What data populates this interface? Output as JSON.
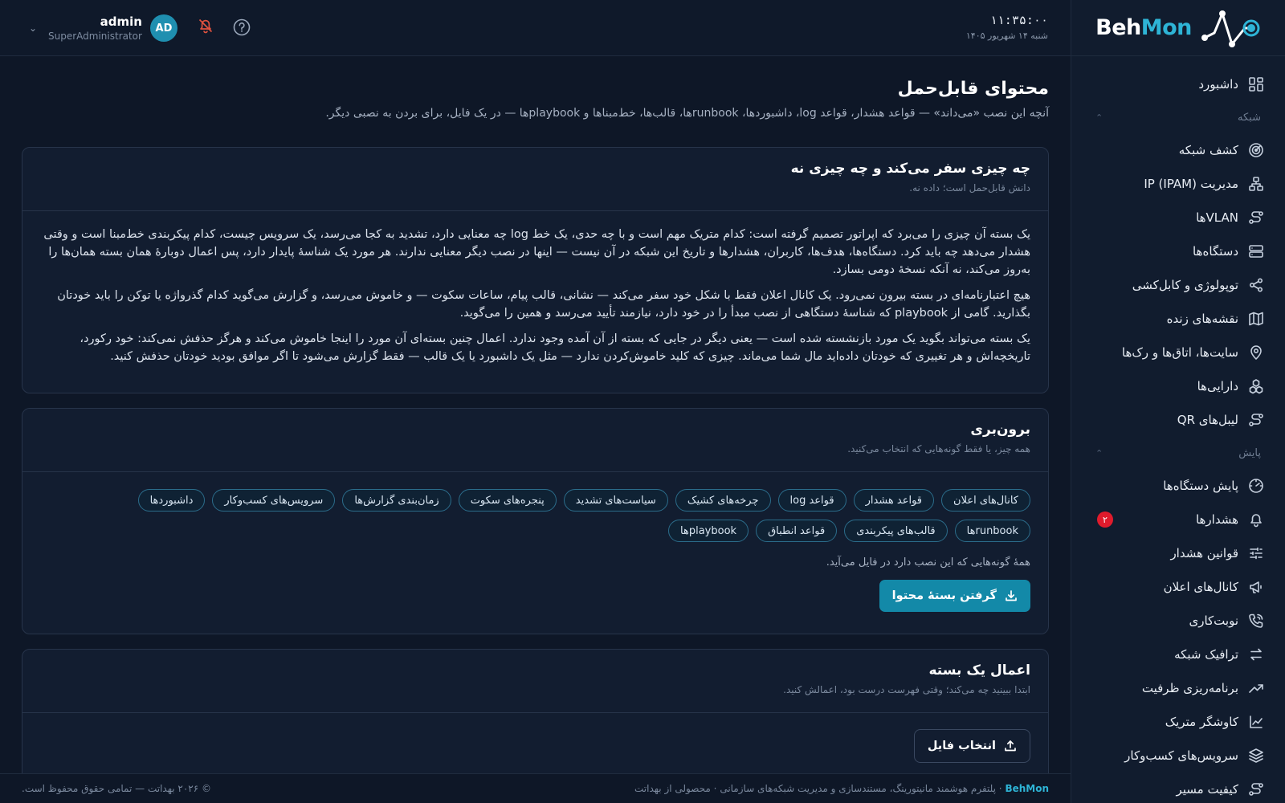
{
  "brand": {
    "part1": "Beh",
    "part2": "Mon"
  },
  "header": {
    "time": "۱۱:۳۵:۰۰",
    "date": "شنبه ۱۴ شهریور ۱۴۰۵",
    "user_name": "admin",
    "user_role": "SuperAdministrator",
    "avatar_initials": "AD"
  },
  "sidebar": {
    "dashboard": "داشبورد",
    "section_network": "شبکه",
    "network_items": [
      {
        "label": "کشف شبکه",
        "icon": "radar-icon"
      },
      {
        "label": "مدیریت IP (IPAM)",
        "icon": "network-tree-icon"
      },
      {
        "label": "VLANها",
        "icon": "route-icon"
      },
      {
        "label": "دستگاه‌ها",
        "icon": "server-icon"
      },
      {
        "label": "توپولوژی و کابل‌کشی",
        "icon": "share-icon"
      },
      {
        "label": "نقشه‌های زنده",
        "icon": "map-icon"
      },
      {
        "label": "سایت‌ها، اتاق‌ها و رک‌ها",
        "icon": "pin-icon"
      },
      {
        "label": "دارایی‌ها",
        "icon": "boxes-icon"
      },
      {
        "label": "لیبل‌های QR",
        "icon": "route-icon"
      }
    ],
    "section_monitor": "پایش",
    "monitor_items": [
      {
        "label": "پایش دستگاه‌ها",
        "icon": "gauge-icon",
        "badge": ""
      },
      {
        "label": "هشدارها",
        "icon": "bell-icon",
        "badge": "۲"
      },
      {
        "label": "قوانین هشدار",
        "icon": "sliders-icon",
        "badge": ""
      },
      {
        "label": "کانال‌های اعلان",
        "icon": "megaphone-icon",
        "badge": ""
      },
      {
        "label": "نوبت‌کاری",
        "icon": "phone-icon",
        "badge": ""
      },
      {
        "label": "ترافیک شبکه",
        "icon": "arrows-icon",
        "badge": ""
      },
      {
        "label": "برنامه‌ریزی ظرفیت",
        "icon": "trend-icon",
        "badge": ""
      },
      {
        "label": "کاوشگر متریک",
        "icon": "line-chart-icon",
        "badge": ""
      },
      {
        "label": "سرویس‌های کسب‌وکار",
        "icon": "layers-icon",
        "badge": ""
      },
      {
        "label": "کیفیت مسیر",
        "icon": "route-icon",
        "badge": ""
      }
    ]
  },
  "page": {
    "title": "محتوای قابل‌حمل",
    "subtitle": "آنچه این نصب «می‌داند» — قواعد هشدار، قواعد log، داشبوردها، runbookها، قالب‌ها، خط‌مبناها و playbookها — در یک فایل، برای بردن به نصبی دیگر."
  },
  "card1": {
    "title": "چه چیزی سفر می‌کند و چه چیزی نه",
    "subtitle": "دانش قابل‌حمل است؛ داده نه.",
    "paragraphs": [
      "یک بسته آن چیزی را می‌برد که اپراتور تصمیم گرفته است: کدام متریک مهم است و با چه حدی، یک خط log چه معنایی دارد، تشدید به کجا می‌رسد، یک سرویس چیست، کدام پیکربندی خط‌مبنا است و وقتی هشدار می‌دهد چه باید کرد. دستگاه‌ها، هدف‌ها، کاربران، هشدارها و تاریخ این شبکه در آن نیست — اینها در نصب دیگر معنایی ندارند. هر مورد یک شناسهٔ پایدار دارد، پس اعمال دوبارهٔ همان بسته همان‌ها را به‌روز می‌کند، نه آنکه نسخهٔ دومی بسازد.",
      "هیچ اعتبارنامه‌ای در بسته بیرون نمی‌رود. یک کانال اعلان فقط با شکل خود سفر می‌کند — نشانی، قالب پیام، ساعات سکوت — و خاموش می‌رسد، و گزارش می‌گوید کدام گذرواژه یا توکن را باید خودتان بگذارید. گامی از playbook که شناسهٔ دستگاهی از نصب مبدأ را در خود دارد، نیازمند تأیید می‌رسد و همین را می‌گوید.",
      "یک بسته می‌تواند بگوید یک مورد بازنشسته شده است — یعنی دیگر در جایی که بسته از آن آمده وجود ندارد. اعمال چنین بسته‌ای آن مورد را اینجا خاموش می‌کند و هرگز حذفش نمی‌کند: خود رکورد، تاریخچه‌اش و هر تغییری که خودتان داده‌اید مال شما می‌ماند. چیزی که کلید خاموش‌کردن ندارد — مثل یک داشبورد یا یک قالب — فقط گزارش می‌شود تا اگر موافق بودید خودتان حذفش کنید."
    ]
  },
  "card2": {
    "title": "برون‌بری",
    "subtitle": "همه چیز، یا فقط گونه‌هایی که انتخاب می‌کنید.",
    "chips": [
      "کانال‌های اعلان",
      "قواعد هشدار",
      "قواعد log",
      "چرخه‌های کشیک",
      "سیاست‌های تشدید",
      "پنجره‌های سکوت",
      "زمان‌بندی گزارش‌ها",
      "سرویس‌های کسب‌وکار",
      "داشبوردها",
      "runbookها",
      "قالب‌های پیکربندی",
      "قواعد انطباق",
      "playbookها"
    ],
    "note": "همهٔ گونه‌هایی که این نصب دارد در فایل می‌آید.",
    "button": "گرفتن بستهٔ محتوا"
  },
  "card3": {
    "title": "اعمال یک بسته",
    "subtitle": "ابتدا ببینید چه می‌کند؛ وقتی فهرست درست بود، اعمالش کنید.",
    "button": "انتخاب فایل"
  },
  "footer": {
    "brand": "BehMon",
    "tagline": "پلتفرم هوشمند مانیتورینگ، مستندسازی و مدیریت شبکه‌های سازمانی",
    "product_of": "محصولی از بهداتت",
    "copyright": "© ۲۰۲۶ بهداتت — تمامی حقوق محفوظ است."
  },
  "colors": {
    "background": "#0e1727",
    "sidebar": "#111c2e",
    "accent": "#1389a8",
    "brand_accent": "#2eb4d6",
    "alert_badge": "#e01b2c"
  }
}
